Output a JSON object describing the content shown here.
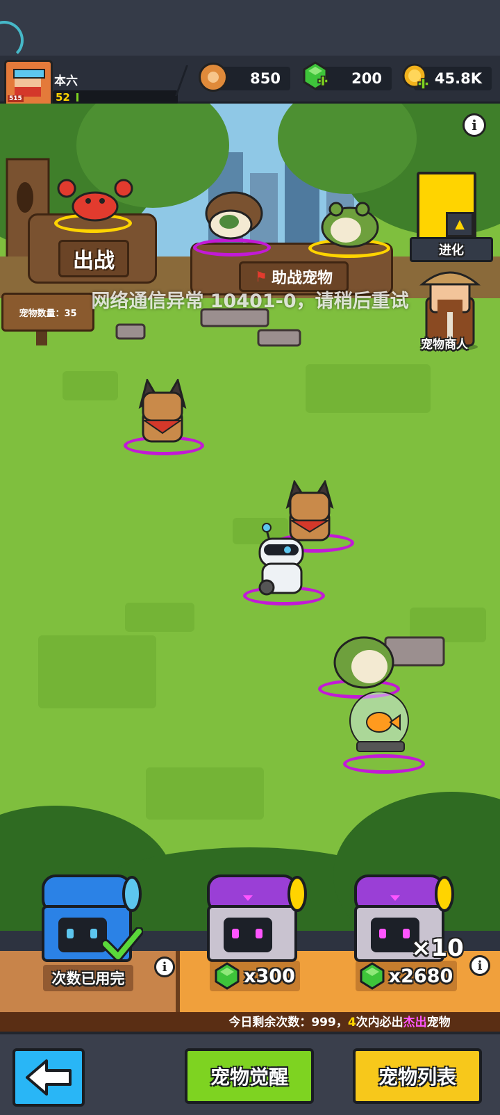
{
  "player": {
    "name": "本六",
    "level": "52",
    "avatar_badge": "515"
  },
  "resources": [
    {
      "name": "coin-currency",
      "value": "850",
      "icon": "paw-coin-icon",
      "color": "#e08a3a"
    },
    {
      "name": "gem-currency",
      "value": "200",
      "icon": "green-gem-plus-icon",
      "color": "#3ec43a"
    },
    {
      "name": "gold-currency",
      "value": "45.8K",
      "icon": "gold-coin-plus-icon",
      "color": "#f2b21c"
    }
  ],
  "scene": {
    "deploy_label": "出战",
    "assist_label": "助战宠物",
    "pet_count_label": "宠物数量：35",
    "evolve_label": "进化",
    "merchant_label": "宠物商人",
    "error_toast": "网络通信异常 10401-0，请稍后重试"
  },
  "chests": [
    {
      "label": "次数已用完",
      "cost": "",
      "multiplier": "",
      "color": "blue"
    },
    {
      "label": "",
      "cost": "x300",
      "multiplier": "",
      "color": "purple"
    },
    {
      "label": "",
      "cost": "x2680",
      "multiplier": "×10",
      "color": "purple"
    }
  ],
  "daily_info": {
    "prefix": "今日剩余次数：999，",
    "count": "4",
    "mid": "次内必出",
    "highlight": "杰出",
    "suffix": "宠物"
  },
  "nav": {
    "awaken_label": "宠物觉醒",
    "list_label": "宠物列表"
  },
  "colors": {
    "grass": "#7fbf3e",
    "awaken_button": "#7ed321",
    "list_button": "#f7c81b",
    "back_button": "#29b6f6",
    "highlight_text": "#ff55ff",
    "count_text": "#ffd400"
  }
}
